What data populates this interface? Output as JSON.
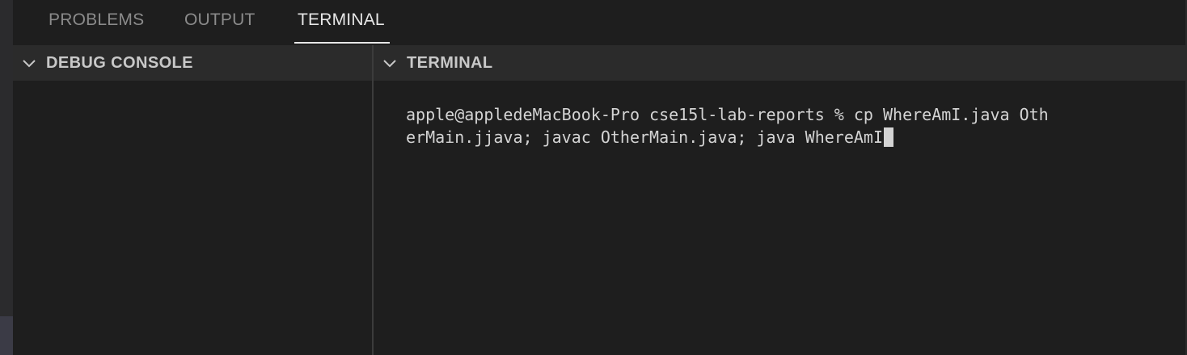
{
  "tabs": [
    {
      "label": "PROBLEMS",
      "active": false
    },
    {
      "label": "OUTPUT",
      "active": false
    },
    {
      "label": "TERMINAL",
      "active": true
    }
  ],
  "panes": {
    "left": {
      "title": "DEBUG CONSOLE",
      "icon": "chevron-down-icon"
    },
    "right": {
      "title": "TERMINAL",
      "icon": "chevron-down-icon"
    }
  },
  "terminal": {
    "line1": "apple@appledeMacBook-Pro cse15l-lab-reports % cp WhereAmI.java Oth",
    "line2": "erMain.jjava; javac OtherMain.java; java WhereAmI"
  },
  "colors": {
    "background": "#1e1e1e",
    "pane_header": "#2b2b2b",
    "active_tab": "#e7e7e7",
    "inactive_tab": "#8b8b8b",
    "terminal_text": "#d4d4d4"
  }
}
